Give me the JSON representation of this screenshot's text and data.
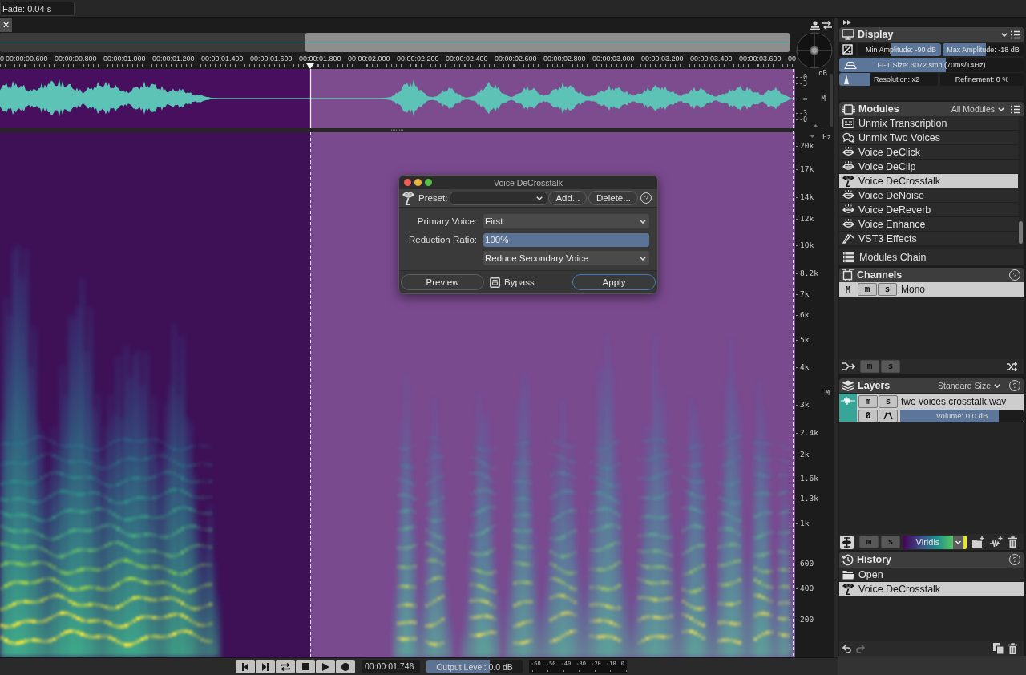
{
  "top_bar": {
    "fade": "Fade: 0.04 s"
  },
  "editor": {
    "close_tab": "×",
    "timeline": [
      "0",
      "00:00:00.600",
      "00:00:00.800",
      "00:00:01.000",
      "00:00:01.200",
      "00:00:01.400",
      "00:00:01.600",
      "00:00:01.800",
      "00:00:02.000",
      "00:00:02.200",
      "00:00:02.400",
      "00:00:02.600",
      "00:00:02.800",
      "00:00:03.000",
      "00:00:03.200",
      "00:00:03.400",
      "00:00:03.600",
      "00"
    ],
    "waveform_scale": {
      "unit": "dB",
      "labels": [
        "-0",
        "-3",
        "-∞",
        "-3",
        "-0"
      ],
      "channel": "M"
    },
    "frequency_axis": {
      "unit": "Hz",
      "labels": [
        "20k",
        "17k",
        "14k",
        "12k",
        "10k",
        "8.2k",
        "7k",
        "6k",
        "5k",
        "4k",
        "3k",
        "2.4k",
        "2k",
        "1.6k",
        "1.3k",
        "1k",
        "600",
        "400",
        "200"
      ],
      "channel": "M"
    }
  },
  "dialog": {
    "title": "Voice DeCrosstalk",
    "preset_label": "Preset:",
    "preset_buttons": [
      "Add...",
      "Delete..."
    ],
    "help": "?",
    "fields": [
      {
        "kind": "select",
        "label": "Primary Voice:",
        "value": "First"
      },
      {
        "kind": "slider",
        "label": "Reduction Ratio:",
        "value": "100%",
        "level": 1
      },
      {
        "kind": "select",
        "value": "Reduce Secondary Voice"
      }
    ],
    "preview": "Preview",
    "bypass": {
      "label": "Bypass",
      "checked": false
    },
    "apply": "Apply"
  },
  "transport": {
    "time": "00:00:01.746",
    "output_level": {
      "label": "Output Level: 0.0 dB",
      "level": 0.66
    },
    "meter_scale": [
      "-60",
      "-50",
      "-40",
      "-30",
      "-20",
      "-10",
      "0"
    ]
  },
  "panels": {
    "display": {
      "title": "Display",
      "rows": [
        [
          {
            "label": "Min Amplitude: -90 dB",
            "level": 0.6
          },
          {
            "label": "Max Amplitude: -18 dB",
            "level": 0.53
          }
        ],
        [
          {
            "label": "FFT Size: 3072 smp (70ms/14Hz)",
            "level": 0.58
          }
        ],
        [
          {
            "label": "Resolution: x2",
            "level": 0.32
          },
          {
            "label": "Refinement: 0 %"
          }
        ]
      ]
    },
    "modules": {
      "title": "Modules",
      "filter": "All Modules",
      "items": [
        {
          "label": "Unmix Transcription",
          "selected": false
        },
        {
          "label": "Unmix Two Voices",
          "selected": false
        },
        {
          "label": "Voice DeClick",
          "selected": false
        },
        {
          "label": "Voice DeClip",
          "selected": false
        },
        {
          "label": "Voice DeCrosstalk",
          "selected": true
        },
        {
          "label": "Voice DeNoise",
          "selected": false
        },
        {
          "label": "Voice DeReverb",
          "selected": false
        },
        {
          "label": "Voice Enhance",
          "selected": false
        },
        {
          "label": "VST3 Effects",
          "selected": false
        }
      ],
      "chain": "Modules Chain"
    },
    "channels": {
      "title": "Channels",
      "help": "?",
      "items": [
        {
          "letter": "M",
          "mute": "m",
          "solo": "s",
          "name": "Mono",
          "selected": true
        }
      ],
      "footer": {
        "mute": "m",
        "solo": "s"
      }
    },
    "layers": {
      "title": "Layers",
      "size": "Standard Size",
      "help": "?",
      "items": [
        {
          "mute": "m",
          "solo": "s",
          "name": "two voices crosstalk.wav",
          "phase": "Ø",
          "volume": {
            "label": "Volume: 0.0 dB",
            "level": 0.8
          },
          "selected": true
        }
      ],
      "footer": {
        "mute": "m",
        "solo": "s",
        "colormap": "Viridis"
      }
    },
    "history": {
      "title": "History",
      "help": "?",
      "items": [
        {
          "label": "Open",
          "selected": false
        },
        {
          "label": "Voice DeCrosstalk",
          "selected": true
        }
      ]
    }
  }
}
